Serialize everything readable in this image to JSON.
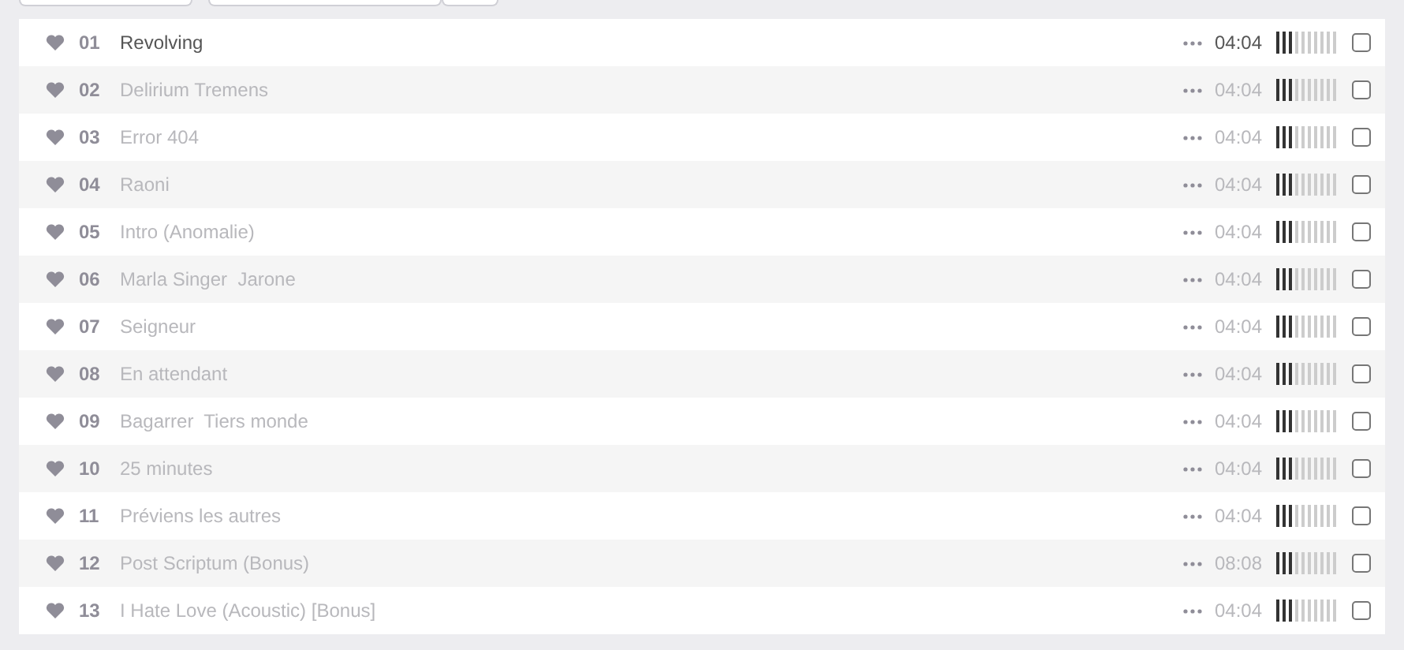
{
  "tracks": [
    {
      "number": "01",
      "title": "Revolving",
      "duration": "04:04",
      "active": true,
      "level": 0.3,
      "checked": false
    },
    {
      "number": "02",
      "title": "Delirium Tremens",
      "duration": "04:04",
      "active": false,
      "level": 0.3,
      "checked": false
    },
    {
      "number": "03",
      "title": "Error 404",
      "duration": "04:04",
      "active": false,
      "level": 0.3,
      "checked": false
    },
    {
      "number": "04",
      "title": "Raoni",
      "duration": "04:04",
      "active": false,
      "level": 0.3,
      "checked": false
    },
    {
      "number": "05",
      "title": "Intro (Anomalie)",
      "duration": "04:04",
      "active": false,
      "level": 0.3,
      "checked": false
    },
    {
      "number": "06",
      "title": "Marla Singer  Jarone",
      "duration": "04:04",
      "active": false,
      "level": 0.3,
      "checked": false
    },
    {
      "number": "07",
      "title": "Seigneur",
      "duration": "04:04",
      "active": false,
      "level": 0.3,
      "checked": false
    },
    {
      "number": "08",
      "title": "En attendant",
      "duration": "04:04",
      "active": false,
      "level": 0.3,
      "checked": false
    },
    {
      "number": "09",
      "title": "Bagarrer  Tiers monde",
      "duration": "04:04",
      "active": false,
      "level": 0.3,
      "checked": false
    },
    {
      "number": "10",
      "title": "25 minutes",
      "duration": "04:04",
      "active": false,
      "level": 0.3,
      "checked": false
    },
    {
      "number": "11",
      "title": "Préviens les autres",
      "duration": "04:04",
      "active": false,
      "level": 0.3,
      "checked": false
    },
    {
      "number": "12",
      "title": "Post Scriptum (Bonus)",
      "duration": "08:08",
      "active": false,
      "level": 0.3,
      "checked": false
    },
    {
      "number": "13",
      "title": "I Hate Love (Acoustic) [Bonus]",
      "duration": "04:04",
      "active": false,
      "level": 0.3,
      "checked": false
    }
  ]
}
